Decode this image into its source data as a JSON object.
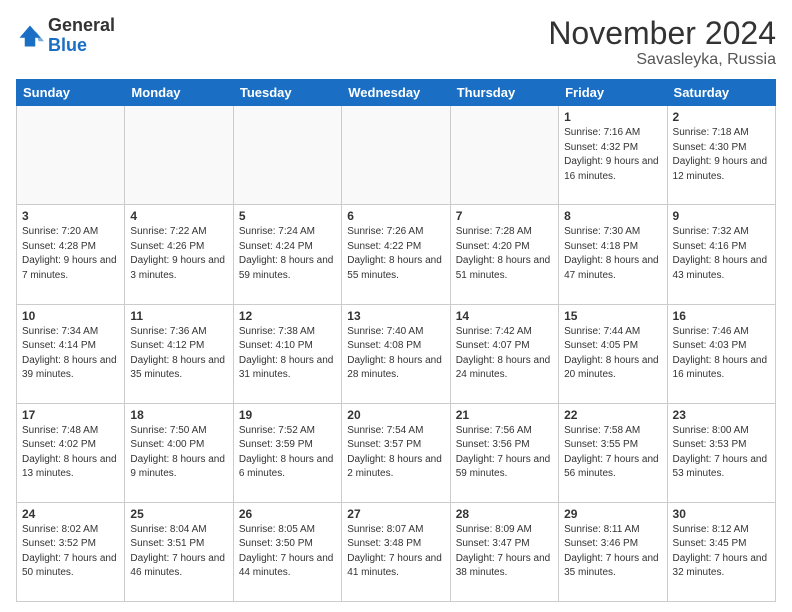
{
  "header": {
    "logo_general": "General",
    "logo_blue": "Blue",
    "month_title": "November 2024",
    "location": "Savasleyka, Russia"
  },
  "days_of_week": [
    "Sunday",
    "Monday",
    "Tuesday",
    "Wednesday",
    "Thursday",
    "Friday",
    "Saturday"
  ],
  "weeks": [
    [
      {
        "day": "",
        "info": ""
      },
      {
        "day": "",
        "info": ""
      },
      {
        "day": "",
        "info": ""
      },
      {
        "day": "",
        "info": ""
      },
      {
        "day": "",
        "info": ""
      },
      {
        "day": "1",
        "info": "Sunrise: 7:16 AM\nSunset: 4:32 PM\nDaylight: 9 hours and 16 minutes."
      },
      {
        "day": "2",
        "info": "Sunrise: 7:18 AM\nSunset: 4:30 PM\nDaylight: 9 hours and 12 minutes."
      }
    ],
    [
      {
        "day": "3",
        "info": "Sunrise: 7:20 AM\nSunset: 4:28 PM\nDaylight: 9 hours and 7 minutes."
      },
      {
        "day": "4",
        "info": "Sunrise: 7:22 AM\nSunset: 4:26 PM\nDaylight: 9 hours and 3 minutes."
      },
      {
        "day": "5",
        "info": "Sunrise: 7:24 AM\nSunset: 4:24 PM\nDaylight: 8 hours and 59 minutes."
      },
      {
        "day": "6",
        "info": "Sunrise: 7:26 AM\nSunset: 4:22 PM\nDaylight: 8 hours and 55 minutes."
      },
      {
        "day": "7",
        "info": "Sunrise: 7:28 AM\nSunset: 4:20 PM\nDaylight: 8 hours and 51 minutes."
      },
      {
        "day": "8",
        "info": "Sunrise: 7:30 AM\nSunset: 4:18 PM\nDaylight: 8 hours and 47 minutes."
      },
      {
        "day": "9",
        "info": "Sunrise: 7:32 AM\nSunset: 4:16 PM\nDaylight: 8 hours and 43 minutes."
      }
    ],
    [
      {
        "day": "10",
        "info": "Sunrise: 7:34 AM\nSunset: 4:14 PM\nDaylight: 8 hours and 39 minutes."
      },
      {
        "day": "11",
        "info": "Sunrise: 7:36 AM\nSunset: 4:12 PM\nDaylight: 8 hours and 35 minutes."
      },
      {
        "day": "12",
        "info": "Sunrise: 7:38 AM\nSunset: 4:10 PM\nDaylight: 8 hours and 31 minutes."
      },
      {
        "day": "13",
        "info": "Sunrise: 7:40 AM\nSunset: 4:08 PM\nDaylight: 8 hours and 28 minutes."
      },
      {
        "day": "14",
        "info": "Sunrise: 7:42 AM\nSunset: 4:07 PM\nDaylight: 8 hours and 24 minutes."
      },
      {
        "day": "15",
        "info": "Sunrise: 7:44 AM\nSunset: 4:05 PM\nDaylight: 8 hours and 20 minutes."
      },
      {
        "day": "16",
        "info": "Sunrise: 7:46 AM\nSunset: 4:03 PM\nDaylight: 8 hours and 16 minutes."
      }
    ],
    [
      {
        "day": "17",
        "info": "Sunrise: 7:48 AM\nSunset: 4:02 PM\nDaylight: 8 hours and 13 minutes."
      },
      {
        "day": "18",
        "info": "Sunrise: 7:50 AM\nSunset: 4:00 PM\nDaylight: 8 hours and 9 minutes."
      },
      {
        "day": "19",
        "info": "Sunrise: 7:52 AM\nSunset: 3:59 PM\nDaylight: 8 hours and 6 minutes."
      },
      {
        "day": "20",
        "info": "Sunrise: 7:54 AM\nSunset: 3:57 PM\nDaylight: 8 hours and 2 minutes."
      },
      {
        "day": "21",
        "info": "Sunrise: 7:56 AM\nSunset: 3:56 PM\nDaylight: 7 hours and 59 minutes."
      },
      {
        "day": "22",
        "info": "Sunrise: 7:58 AM\nSunset: 3:55 PM\nDaylight: 7 hours and 56 minutes."
      },
      {
        "day": "23",
        "info": "Sunrise: 8:00 AM\nSunset: 3:53 PM\nDaylight: 7 hours and 53 minutes."
      }
    ],
    [
      {
        "day": "24",
        "info": "Sunrise: 8:02 AM\nSunset: 3:52 PM\nDaylight: 7 hours and 50 minutes."
      },
      {
        "day": "25",
        "info": "Sunrise: 8:04 AM\nSunset: 3:51 PM\nDaylight: 7 hours and 46 minutes."
      },
      {
        "day": "26",
        "info": "Sunrise: 8:05 AM\nSunset: 3:50 PM\nDaylight: 7 hours and 44 minutes."
      },
      {
        "day": "27",
        "info": "Sunrise: 8:07 AM\nSunset: 3:48 PM\nDaylight: 7 hours and 41 minutes."
      },
      {
        "day": "28",
        "info": "Sunrise: 8:09 AM\nSunset: 3:47 PM\nDaylight: 7 hours and 38 minutes."
      },
      {
        "day": "29",
        "info": "Sunrise: 8:11 AM\nSunset: 3:46 PM\nDaylight: 7 hours and 35 minutes."
      },
      {
        "day": "30",
        "info": "Sunrise: 8:12 AM\nSunset: 3:45 PM\nDaylight: 7 hours and 32 minutes."
      }
    ]
  ]
}
